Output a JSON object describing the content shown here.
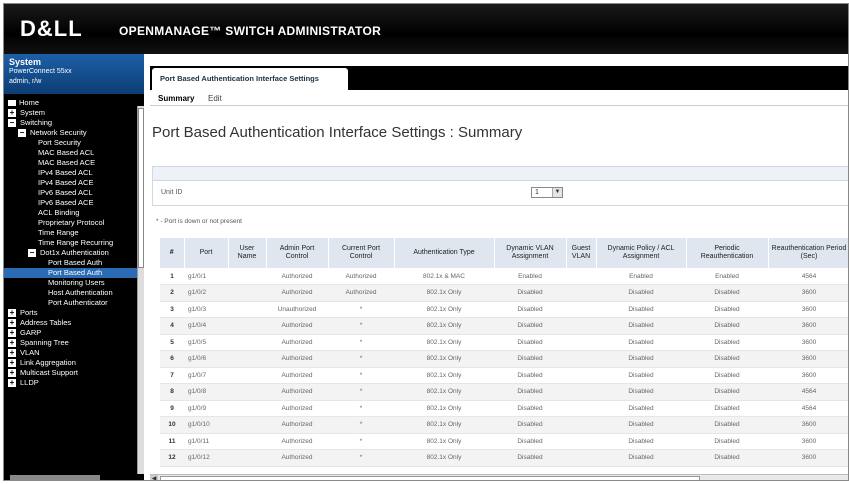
{
  "banner": {
    "logo": "D&LL",
    "title": "OPENMANAGE™ SWITCH ADMINISTRATOR"
  },
  "system": {
    "title": "System",
    "model": "PowerConnect 55xx",
    "user": "admin, r/w"
  },
  "nav": [
    {
      "label": "Home",
      "indent": 0,
      "icon": "home-icon",
      "selected": false
    },
    {
      "label": "System",
      "indent": 0,
      "icon": "plus",
      "selected": false
    },
    {
      "label": "Switching",
      "indent": 0,
      "icon": "minus",
      "selected": false
    },
    {
      "label": "Network Security",
      "indent": 1,
      "icon": "minus",
      "selected": false
    },
    {
      "label": "Port Security",
      "indent": 2,
      "icon": "",
      "selected": false
    },
    {
      "label": "MAC Based ACL",
      "indent": 2,
      "icon": "",
      "selected": false
    },
    {
      "label": "MAC Based ACE",
      "indent": 2,
      "icon": "",
      "selected": false
    },
    {
      "label": "IPv4 Based ACL",
      "indent": 2,
      "icon": "",
      "selected": false
    },
    {
      "label": "IPv4 Based ACE",
      "indent": 2,
      "icon": "",
      "selected": false
    },
    {
      "label": "IPv6 Based ACL",
      "indent": 2,
      "icon": "",
      "selected": false
    },
    {
      "label": "IPv6 Based ACE",
      "indent": 2,
      "icon": "",
      "selected": false
    },
    {
      "label": "ACL Binding",
      "indent": 2,
      "icon": "",
      "selected": false
    },
    {
      "label": "Proprietary Protocol",
      "indent": 2,
      "icon": "",
      "selected": false
    },
    {
      "label": "Time Range",
      "indent": 2,
      "icon": "",
      "selected": false
    },
    {
      "label": "Time Range Recurring",
      "indent": 2,
      "icon": "",
      "selected": false
    },
    {
      "label": "Dot1x Authentication",
      "indent": 2,
      "icon": "minus",
      "selected": false
    },
    {
      "label": "Port Based Auth",
      "indent": 3,
      "icon": "",
      "selected": false
    },
    {
      "label": "Port Based Auth",
      "indent": 3,
      "icon": "",
      "selected": true
    },
    {
      "label": "Monitoring Users",
      "indent": 3,
      "icon": "",
      "selected": false
    },
    {
      "label": "Host Authentication",
      "indent": 3,
      "icon": "",
      "selected": false
    },
    {
      "label": "Port Authenticator",
      "indent": 3,
      "icon": "",
      "selected": false
    },
    {
      "label": "Ports",
      "indent": 0,
      "icon": "plus",
      "selected": false
    },
    {
      "label": "Address Tables",
      "indent": 0,
      "icon": "plus",
      "selected": false
    },
    {
      "label": "GARP",
      "indent": 0,
      "icon": "plus",
      "selected": false
    },
    {
      "label": "Spanning Tree",
      "indent": 0,
      "icon": "plus",
      "selected": false
    },
    {
      "label": "VLAN",
      "indent": 0,
      "icon": "plus",
      "selected": false
    },
    {
      "label": "Link Aggregation",
      "indent": 0,
      "icon": "plus",
      "selected": false
    },
    {
      "label": "Multicast Support",
      "indent": 0,
      "icon": "plus",
      "selected": false
    },
    {
      "label": "LLDP",
      "indent": 0,
      "icon": "plus",
      "selected": false
    }
  ],
  "tab": {
    "label": "Port Based Authentication Interface Settings"
  },
  "subtabs": {
    "summary": "Summary",
    "edit": "Edit"
  },
  "page": {
    "title": "Port Based Authentication Interface Settings : Summary",
    "unit_label": "Unit ID",
    "unit_value": "1",
    "note": "* - Port is down or not present"
  },
  "table": {
    "headers": [
      "#",
      "Port",
      "User Name",
      "Admin Port Control",
      "Current Port Control",
      "Authentication Type",
      "Dynamic VLAN Assignment",
      "Guest VLAN",
      "Dynamic Policy / ACL Assignment",
      "Periodic Reauthentication",
      "Reauthentication Period (Sec)"
    ],
    "rows": [
      [
        "1",
        "g1/0/1",
        "",
        "Authorized",
        "Authorized",
        "802.1x & MAC",
        "Enabled",
        "",
        "Enabled",
        "Enabled",
        "4564"
      ],
      [
        "2",
        "g1/0/2",
        "",
        "Authorized",
        "Authorized",
        "802.1x Only",
        "Disabled",
        "",
        "Disabled",
        "Disabled",
        "3600"
      ],
      [
        "3",
        "g1/0/3",
        "",
        "Unauthorized",
        "*",
        "802.1x Only",
        "Disabled",
        "",
        "Disabled",
        "Disabled",
        "3600"
      ],
      [
        "4",
        "g1/0/4",
        "",
        "Authorized",
        "*",
        "802.1x Only",
        "Disabled",
        "",
        "Disabled",
        "Disabled",
        "3600"
      ],
      [
        "5",
        "g1/0/5",
        "",
        "Authorized",
        "*",
        "802.1x Only",
        "Disabled",
        "",
        "Disabled",
        "Disabled",
        "3600"
      ],
      [
        "6",
        "g1/0/6",
        "",
        "Authorized",
        "*",
        "802.1x Only",
        "Disabled",
        "",
        "Disabled",
        "Disabled",
        "3600"
      ],
      [
        "7",
        "g1/0/7",
        "",
        "Authorized",
        "*",
        "802.1x Only",
        "Disabled",
        "",
        "Disabled",
        "Disabled",
        "3600"
      ],
      [
        "8",
        "g1/0/8",
        "",
        "Authorized",
        "*",
        "802.1x Only",
        "Disabled",
        "",
        "Disabled",
        "Disabled",
        "4564"
      ],
      [
        "9",
        "g1/0/9",
        "",
        "Authorized",
        "*",
        "802.1x Only",
        "Disabled",
        "",
        "Disabled",
        "Disabled",
        "4564"
      ],
      [
        "10",
        "g1/0/10",
        "",
        "Authorized",
        "*",
        "802.1x Only",
        "Disabled",
        "",
        "Disabled",
        "Disabled",
        "3600"
      ],
      [
        "11",
        "g1/0/11",
        "",
        "Authorized",
        "*",
        "802.1x Only",
        "Disabled",
        "",
        "Disabled",
        "Disabled",
        "3600"
      ],
      [
        "12",
        "g1/0/12",
        "",
        "Authorized",
        "*",
        "802.1x Only",
        "Disabled",
        "",
        "Disabled",
        "Disabled",
        "3600"
      ]
    ]
  }
}
